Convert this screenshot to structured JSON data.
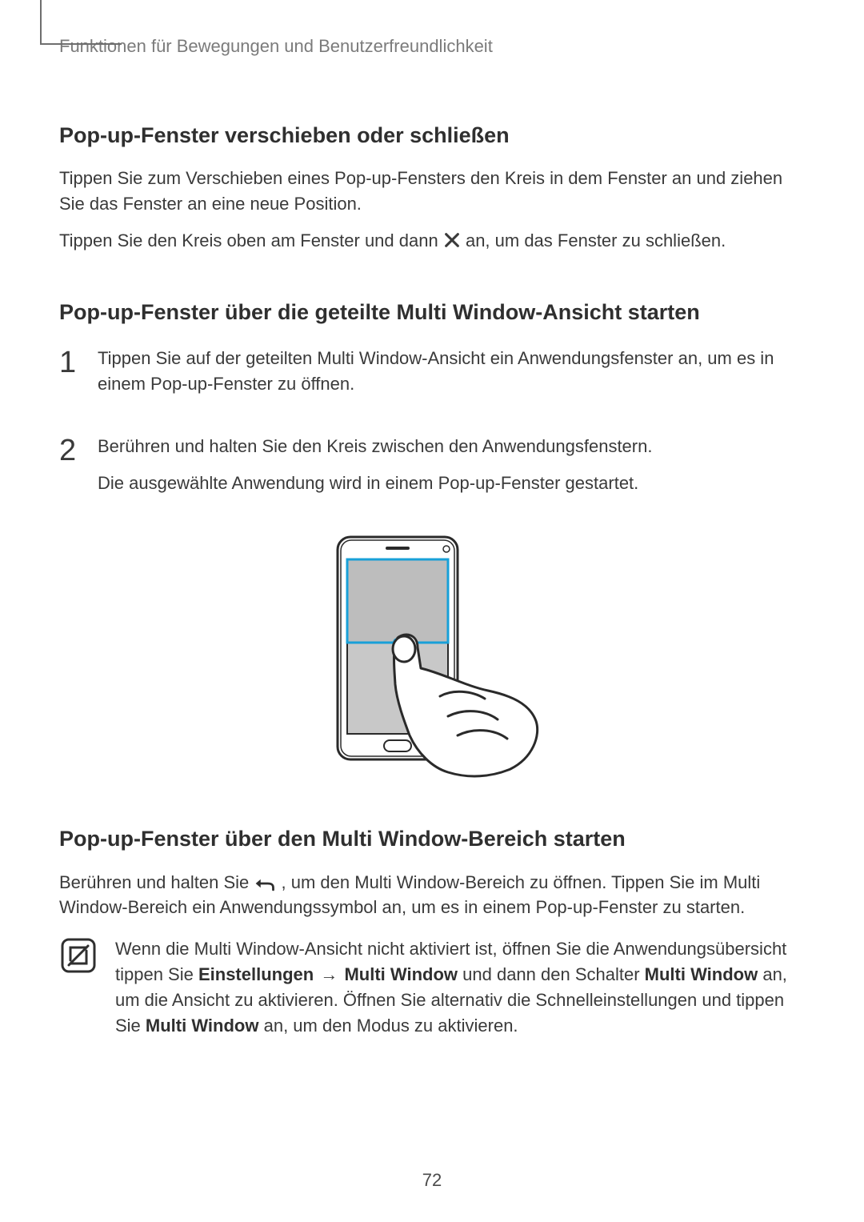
{
  "running_head": "Funktionen für Bewegungen und Benutzerfreundlichkeit",
  "section1": {
    "title": "Pop-up-Fenster verschieben oder schließen",
    "p1": "Tippen Sie zum Verschieben eines Pop-up-Fensters den Kreis in dem Fenster an und ziehen Sie das Fenster an eine neue Position.",
    "p2a": "Tippen Sie den Kreis oben am Fenster und dann ",
    "p2b": " an, um das Fenster zu schließen."
  },
  "section2": {
    "title": "Pop-up-Fenster über die geteilte Multi Window-Ansicht starten",
    "steps": [
      {
        "num": "1",
        "text": "Tippen Sie auf der geteilten Multi Window-Ansicht ein Anwendungsfenster an, um es in einem Pop-up-Fenster zu öffnen."
      },
      {
        "num": "2",
        "line1": "Berühren und halten Sie den Kreis zwischen den Anwendungsfenstern.",
        "line2": "Die ausgewählte Anwendung wird in einem Pop-up-Fenster gestartet."
      }
    ]
  },
  "section3": {
    "title": "Pop-up-Fenster über den Multi Window-Bereich starten",
    "p1a": "Berühren und halten Sie ",
    "p1b": ", um den Multi Window-Bereich zu öffnen. Tippen Sie im Multi Window-Bereich ein Anwendungssymbol an, um es in einem Pop-up-Fenster zu starten.",
    "note": {
      "t1": "Wenn die Multi Window-Ansicht nicht aktiviert ist, öffnen Sie die Anwendungsübersicht tippen Sie ",
      "b1": "Einstellungen",
      "arrow": " → ",
      "b2": "Multi Window",
      "t2": " und dann den Schalter ",
      "b3": "Multi Window",
      "t3": " an, um die Ansicht zu aktivieren. Öffnen Sie alternativ die Schnelleinstellungen und tippen Sie ",
      "b4": "Multi Window",
      "t4": " an, um den Modus zu aktivieren."
    }
  },
  "page_number": "72"
}
